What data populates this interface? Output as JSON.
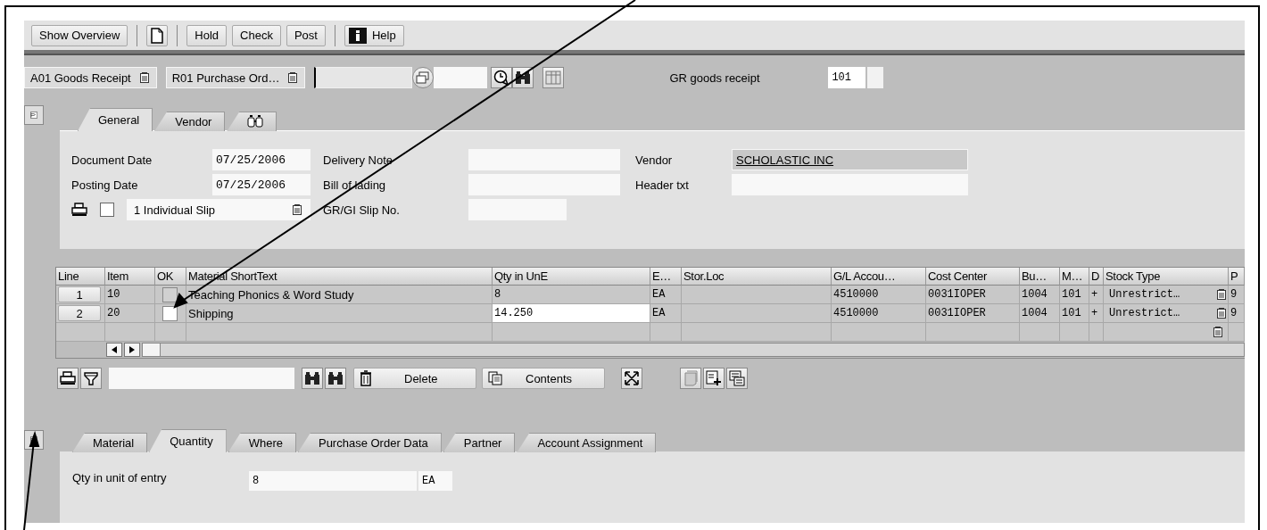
{
  "toolbar": {
    "buttons": [
      {
        "kind": "text",
        "label": "Show Overview"
      },
      {
        "kind": "new-document"
      },
      {
        "kind": "text",
        "label": "Hold"
      },
      {
        "kind": "text",
        "label": "Check"
      },
      {
        "kind": "text",
        "label": "Post"
      },
      {
        "kind": "info",
        "label": "Help"
      }
    ]
  },
  "selection": {
    "transaction": "A01 Goods Receipt",
    "reference": "R01 Purchase Ord…",
    "movement_label": "GR goods receipt",
    "movement_type": "101"
  },
  "header_tabs": [
    {
      "kind": "text",
      "label": "General",
      "selected": true
    },
    {
      "kind": "text",
      "label": "Vendor",
      "selected": false
    },
    {
      "kind": "icon",
      "selected": false
    }
  ],
  "general": {
    "fields": [
      {
        "label": "Document Date",
        "value": "07/25/2006"
      },
      {
        "label": "Delivery Note"
      },
      {
        "label": "Vendor",
        "value": "SCHOLASTIC INC",
        "link": true
      },
      {
        "label": "Posting Date",
        "value": "07/25/2006"
      },
      {
        "label": "Bill of lading"
      },
      {
        "label": "Header txt"
      }
    ],
    "print_checked": false,
    "slip_option": "1 Individual Slip",
    "slip_label": "GR/GI Slip No."
  },
  "table": {
    "columns": [
      "Line",
      "Item",
      "OK",
      "Material ShortText",
      "Qty in UnE",
      "E…",
      "Stor.Loc",
      "G/L Accou…",
      "Cost Center",
      "Bu…",
      "M…",
      "D",
      "Stock Type",
      "P"
    ],
    "rows": [
      {
        "line": "1",
        "item": "10",
        "ok": false,
        "ok_disabled": true,
        "material": "Teaching Phonics & Word Study",
        "qty": "8",
        "qty_editable": false,
        "unit": "EA",
        "gl_account": "4510000",
        "cost_center": "0031IOPER",
        "bu": "1004",
        "m": "101",
        "d": "+",
        "stock_type": "Unrestrict…",
        "column_14": "9"
      },
      {
        "line": "2",
        "item": "20",
        "ok": false,
        "ok_disabled": false,
        "material": "Shipping",
        "qty": "14.250",
        "qty_editable": true,
        "unit": "EA",
        "gl_account": "4510000",
        "cost_center": "0031IOPER",
        "bu": "1004",
        "m": "101",
        "d": "+",
        "stock_type": "Unrestrict…",
        "column_14": "9"
      }
    ]
  },
  "table_toolbar": {
    "delete": "Delete",
    "contents": "Contents"
  },
  "item_tabs": [
    {
      "label": "Material",
      "selected": false
    },
    {
      "label": "Quantity",
      "selected": true
    },
    {
      "label": "Where",
      "selected": false
    },
    {
      "label": "Purchase Order Data",
      "selected": false
    },
    {
      "label": "Partner",
      "selected": false
    },
    {
      "label": "Account Assignment",
      "selected": false
    }
  ],
  "quantity": {
    "label": "Qty in unit of entry",
    "value": "8",
    "unit": "EA"
  }
}
